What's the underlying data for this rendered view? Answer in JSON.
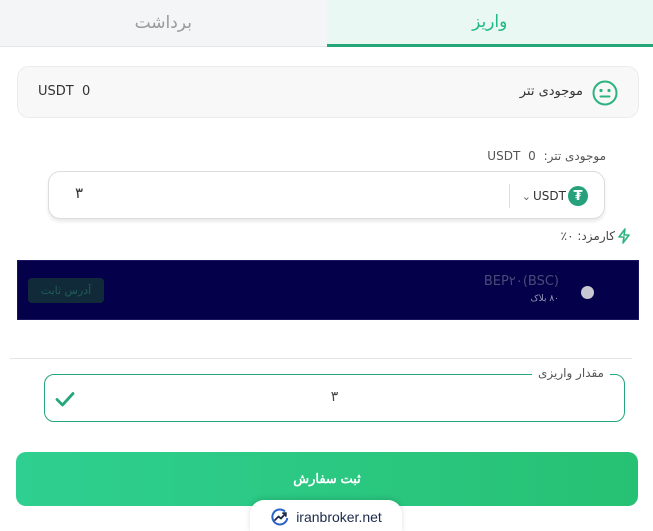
{
  "tabs": {
    "withdraw_label": "برداشت",
    "deposit_label": "واریز"
  },
  "balance": {
    "label": "موجودی تتر",
    "value": "USDT  0",
    "icon": "neutral-face-icon"
  },
  "available": {
    "label": "موجودی تتر:",
    "amount": "0",
    "unit": "USDT"
  },
  "amount_input": {
    "value": "۳",
    "currency": "USDT",
    "currency_icon": "tether-icon"
  },
  "fee": {
    "label": "کارمزد: ۰٪"
  },
  "network": {
    "name": "BEP۲۰(BSC)",
    "blocks": "۸۰ بلاک",
    "badge": "آدرس ثابت"
  },
  "deposit_amount": {
    "legend": "مقدار واریزی",
    "value": "۳"
  },
  "submit": {
    "label": "ثبت سفارش"
  },
  "watermark": {
    "text": "iranbroker.net"
  },
  "colors": {
    "accent": "#25a77a",
    "network_bg": "#05004a",
    "button_start": "#2ecf90",
    "button_end": "#27c173"
  }
}
